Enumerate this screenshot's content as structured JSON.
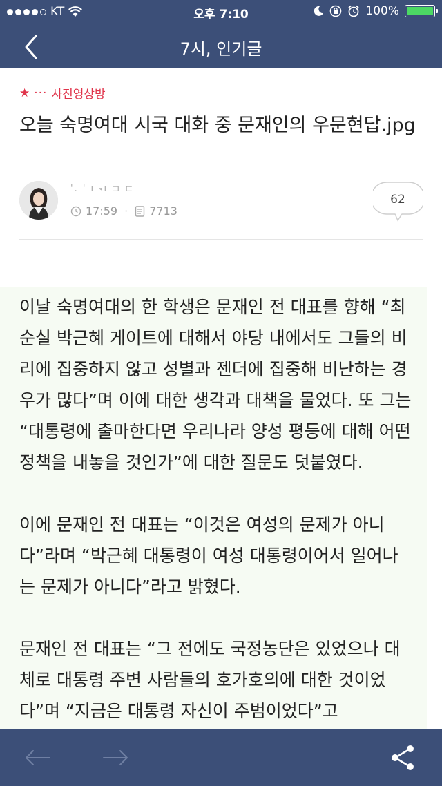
{
  "status_bar": {
    "carrier": "KT",
    "time": "오후 7:10",
    "battery": "100%"
  },
  "nav": {
    "title": "7시, 인기글"
  },
  "post": {
    "board_star": "★",
    "board_ellipsis": "···",
    "board_name": "사진영상방",
    "title": "오늘 숙명여대 시국 대화 중 문재인의 우문현답.jpg",
    "author": "'. ' ı ₃ı ⊐ ⊏",
    "time": "17:59",
    "views": "7713",
    "comment_count": "62"
  },
  "content": {
    "paragraphs": [
      "이날 숙명여대의 한 학생은 문재인 전 대표를 향해 “최순실 박근혜 게이트에 대해서 야당 내에서도 그들의 비리에 집중하지 않고 성별과 젠더에 집중해 비난하는 경우가 많다”며 이에 대한 생각과 대책을 물었다. 또 그는 “대통령에 출마한다면 우리나라 양성 평등에 대해 어떤 정책을 내놓을 것인가”에 대한 질문도 덧붙였다.",
      "이에 문재인 전 대표는 “이것은 여성의 문제가 아니다”라며 “박근혜 대통령이 여성 대통령이어서 일어나는 문제가 아니다”라고 밝혔다.",
      "문재인 전 대표는 “그 전에도 국정농단은 있었으나 대체로 대통령 주변 사람들의 호가호의에 대한 것이었다”며 “지금은 대통령 자신이 주범이었다”고"
    ]
  },
  "colors": {
    "header_bg": "#3c4f78",
    "board_accent": "#e0344b",
    "content_bg": "#f6fbf3",
    "battery_green": "#4cd964"
  },
  "icons": [
    "wifi-icon",
    "moon-icon",
    "rotation-lock-icon",
    "alarm-icon",
    "battery-icon",
    "back-chevron-icon",
    "clock-icon",
    "document-icon",
    "comment-bubble-icon",
    "arrow-left-icon",
    "arrow-right-icon",
    "share-icon"
  ]
}
